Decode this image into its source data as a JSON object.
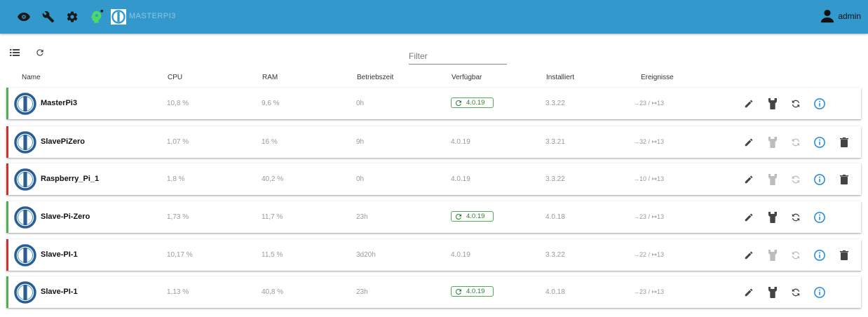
{
  "app": {
    "hostname": "MASTERPI3",
    "user": "admin"
  },
  "icons": {
    "top": [
      "eye-icon",
      "wrench-icon",
      "gear-icon",
      "logo-icon",
      "user-icon"
    ],
    "toolbar": [
      "list-icon",
      "refresh-icon"
    ],
    "actions": [
      "pencil-icon",
      "wrench-icon",
      "sync-icon",
      "info-icon",
      "trash-icon"
    ]
  },
  "filter": {
    "placeholder": "Filter",
    "value": ""
  },
  "columns": [
    "Name",
    "CPU",
    "RAM",
    "Betriebszeit",
    "Verfügbar",
    "Installiert",
    "Ereignisse"
  ],
  "hosts": [
    {
      "name": "MasterPi3",
      "cpu": "10,8 %",
      "ram": "9,6 %",
      "uptime": "0h",
      "available": "4.0.19",
      "installed": "3.3.22",
      "events": "→23 / ↦13",
      "status": "online",
      "update": true
    },
    {
      "name": "SlavePiZero",
      "cpu": "1,07 %",
      "ram": "16 %",
      "uptime": "9h",
      "available": "4.0.19",
      "installed": "3.3.21",
      "events": "→32 / ↦13",
      "status": "offline",
      "update": false
    },
    {
      "name": "Raspberry_Pi_1",
      "cpu": "1,8 %",
      "ram": "40,2 %",
      "uptime": "0h",
      "available": "4.0.19",
      "installed": "3.3.22",
      "events": "→10 / ↦13",
      "status": "offline",
      "update": false
    },
    {
      "name": "Slave-Pi-Zero",
      "cpu": "1,73 %",
      "ram": "11,7 %",
      "uptime": "23h",
      "available": "4.0.19",
      "installed": "4.0.18",
      "events": "→23 / ↦13",
      "status": "online",
      "update": true
    },
    {
      "name": "Slave-PI-1",
      "cpu": "10,17 %",
      "ram": "11,5 %",
      "uptime": "3d20h",
      "available": "4.0.19",
      "installed": "3.3.22",
      "events": "→22 / ↦13",
      "status": "offline",
      "update": false
    },
    {
      "name": "Slave-PI-1",
      "cpu": "1,13 %",
      "ram": "40,8 %",
      "uptime": "23h",
      "available": "4.0.19",
      "installed": "4.0.18",
      "events": "→23 / ↦13",
      "status": "online",
      "update": true
    }
  ],
  "colors": {
    "topbar": "#3399cc",
    "online": "#4caf50",
    "offline": "#d32f2f",
    "info": "#1e88e5"
  }
}
